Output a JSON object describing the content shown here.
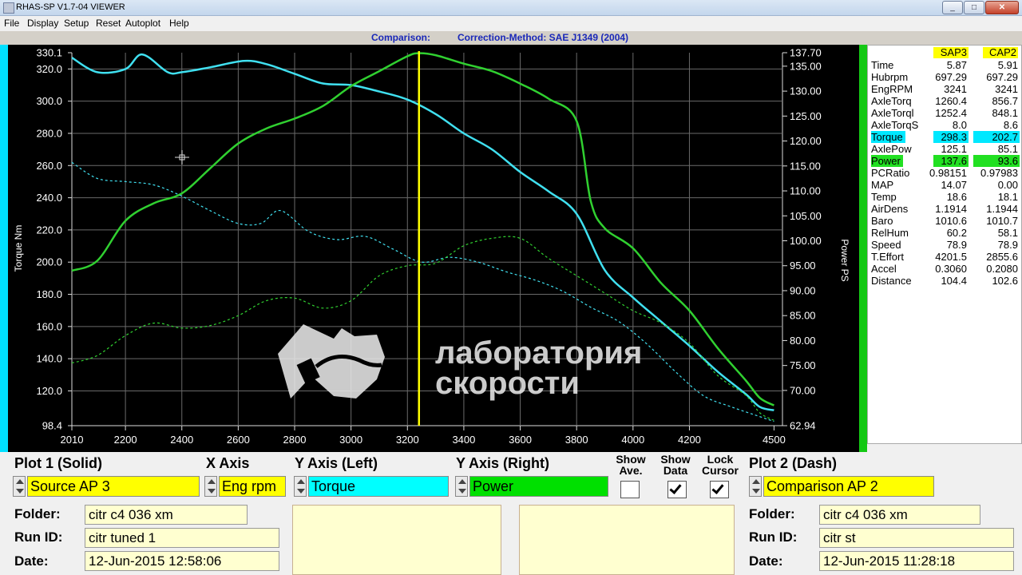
{
  "window": {
    "title": "RHAS-SP V1.7-04  VIEWER",
    "btn_min": "_",
    "btn_max": "□",
    "btn_close": "✕"
  },
  "menu": [
    "File",
    "Display",
    "Setup",
    "Reset",
    "Autoplot",
    "Help"
  ],
  "header": {
    "comparison": "Comparison:",
    "correction": "Correction-Method: SAE J1349 (2004)"
  },
  "watermark": {
    "line1": "лаборатория",
    "line2": "скорости"
  },
  "chart_data": {
    "type": "line",
    "xlabel": "",
    "ylabel_left": "Torque Nm",
    "ylabel_right": "Power PS",
    "x_ticks": [
      2010,
      2200,
      2400,
      2600,
      2800,
      3000,
      3200,
      3400,
      3600,
      3800,
      4000,
      4200,
      4500
    ],
    "left_ticks": [
      "330.1",
      "320.0",
      "300.0",
      "280.0",
      "260.0",
      "240.0",
      "220.0",
      "200.0",
      "180.0",
      "160.0",
      "140.0",
      "120.0",
      "98.4"
    ],
    "left_ylim": [
      98.4,
      330.1
    ],
    "right_ticks": [
      "137.70",
      "135.00",
      "130.00",
      "125.00",
      "120.00",
      "115.00",
      "110.00",
      "105.00",
      "100.00",
      "95.00",
      "90.00",
      "85.00",
      "80.00",
      "75.00",
      "70.00",
      "62.94"
    ],
    "right_ylim": [
      62.94,
      137.7
    ],
    "xlim": [
      2010,
      4530
    ],
    "cursor_rpm": 3241,
    "colors": {
      "torque": "#40e0f0",
      "power": "#30d030",
      "cursor": "#ffff00",
      "grid": "#6a6a6a"
    },
    "series": [
      {
        "name": "Torque",
        "axis": "left",
        "style": "solid",
        "color": "#40e0f0",
        "x": [
          2010,
          2100,
          2200,
          2260,
          2350,
          2400,
          2500,
          2620,
          2700,
          2800,
          2900,
          3000,
          3100,
          3200,
          3300,
          3400,
          3500,
          3600,
          3700,
          3800,
          3900,
          4000,
          4100,
          4200,
          4300,
          4400,
          4450,
          4500
        ],
        "y": [
          327,
          318,
          320,
          329,
          318,
          318,
          321,
          325,
          323,
          317,
          311,
          310,
          306,
          301,
          292,
          280,
          270,
          256,
          244,
          230,
          195,
          178,
          163,
          148,
          132,
          118,
          110,
          108
        ]
      },
      {
        "name": "Power",
        "axis": "right",
        "style": "solid",
        "color": "#30d030",
        "x": [
          2010,
          2100,
          2200,
          2300,
          2400,
          2500,
          2600,
          2700,
          2800,
          2900,
          3000,
          3100,
          3200,
          3241,
          3300,
          3400,
          3500,
          3600,
          3700,
          3800,
          3850,
          3900,
          4000,
          4100,
          4200,
          4300,
          4400,
          4450,
          4500
        ],
        "y": [
          94,
          96,
          104,
          107.5,
          109.5,
          114.5,
          119.5,
          122.5,
          124.5,
          127,
          131,
          134,
          137,
          137.6,
          137.2,
          135.5,
          134,
          131.5,
          128.5,
          124,
          108,
          102.5,
          98.5,
          91.5,
          86,
          78.5,
          72,
          68.5,
          67
        ]
      },
      {
        "name": "Comparison Torque",
        "axis": "left",
        "style": "dash",
        "color": "#40e0f0",
        "x": [
          2010,
          2100,
          2200,
          2300,
          2400,
          2500,
          2600,
          2680,
          2750,
          2850,
          2950,
          3050,
          3150,
          3250,
          3350,
          3450,
          3550,
          3650,
          3750,
          3850,
          3950,
          4050,
          4150,
          4250,
          4350,
          4450,
          4500
        ],
        "y": [
          262,
          252,
          250,
          248,
          241,
          232,
          224,
          224,
          232,
          219,
          214,
          216,
          208,
          200,
          203,
          200,
          194,
          189,
          182,
          172,
          163,
          149,
          132,
          117,
          110,
          104,
          101
        ]
      },
      {
        "name": "Comparison Power",
        "axis": "right",
        "style": "dash",
        "color": "#30d030",
        "x": [
          2010,
          2100,
          2200,
          2300,
          2400,
          2500,
          2600,
          2700,
          2800,
          2900,
          3000,
          3100,
          3200,
          3300,
          3400,
          3500,
          3600,
          3700,
          3800,
          3900,
          4000,
          4100,
          4200,
          4300,
          4400,
          4450,
          4500
        ],
        "y": [
          75.5,
          77,
          81,
          83.5,
          82.5,
          83,
          85,
          88,
          88.5,
          86.5,
          88,
          93,
          95,
          95.5,
          99,
          100.5,
          100.5,
          96.5,
          93,
          89.5,
          86,
          83.5,
          79.5,
          73,
          69,
          65.5,
          64
        ]
      }
    ]
  },
  "data_table": {
    "col1": "SAP3",
    "col2": "CAP2",
    "rows": [
      {
        "name": "Time",
        "v1": "5.87",
        "v2": "5.91",
        "hl": ""
      },
      {
        "name": "Hubrpm",
        "v1": "697.29",
        "v2": "697.29",
        "hl": ""
      },
      {
        "name": "EngRPM",
        "v1": "3241",
        "v2": "3241",
        "hl": ""
      },
      {
        "name": "AxleTorq",
        "v1": "1260.4",
        "v2": "856.7",
        "hl": ""
      },
      {
        "name": "AxleTorql",
        "v1": "1252.4",
        "v2": "848.1",
        "hl": ""
      },
      {
        "name": "AxleTorqS",
        "v1": "8.0",
        "v2": "8.6",
        "hl": ""
      },
      {
        "name": "Torque",
        "v1": "298.3",
        "v2": "202.7",
        "hl": "cyan"
      },
      {
        "name": "AxlePow",
        "v1": "125.1",
        "v2": "85.1",
        "hl": ""
      },
      {
        "name": "Power",
        "v1": "137.6",
        "v2": "93.6",
        "hl": "green"
      },
      {
        "name": "PCRatio",
        "v1": "0.98151",
        "v2": "0.97983",
        "hl": ""
      },
      {
        "name": "MAP",
        "v1": "14.07",
        "v2": "0.00",
        "hl": ""
      },
      {
        "name": "Temp",
        "v1": "18.6",
        "v2": "18.1",
        "hl": ""
      },
      {
        "name": "AirDens",
        "v1": "1.1914",
        "v2": "1.1944",
        "hl": ""
      },
      {
        "name": "Baro",
        "v1": "1010.6",
        "v2": "1010.7",
        "hl": ""
      },
      {
        "name": "RelHum",
        "v1": "60.2",
        "v2": "58.1",
        "hl": ""
      },
      {
        "name": "Speed",
        "v1": "78.9",
        "v2": "78.9",
        "hl": ""
      },
      {
        "name": "T.Effort",
        "v1": "4201.5",
        "v2": "2855.6",
        "hl": ""
      },
      {
        "name": "Accel",
        "v1": "0.3060",
        "v2": "0.2080",
        "hl": ""
      },
      {
        "name": "Distance",
        "v1": "104.4",
        "v2": "102.6",
        "hl": ""
      }
    ]
  },
  "controls": {
    "plot1_title": "Plot 1 (Solid)",
    "xaxis_title": "X Axis",
    "yleft_title": "Y Axis (Left)",
    "yright_title": "Y Axis (Right)",
    "show_ave": "Show Ave.",
    "show_data": "Show Data",
    "lock_cursor": "Lock Cursor",
    "plot2_title": "Plot 2 (Dash)",
    "plot1_value": "Source AP 3",
    "xaxis_value": "Eng rpm",
    "yleft_value": "Torque",
    "yright_value": "Power",
    "plot2_value": "Comparison AP 2",
    "show_ave_checked": false,
    "show_data_checked": true,
    "lock_cursor_checked": true,
    "colors": {
      "plot1": "#ffff00",
      "xaxis": "#ffff00",
      "yleft": "#00ffff",
      "yright": "#00e000",
      "plot2": "#ffff00"
    }
  },
  "run1": {
    "folder_label": "Folder:",
    "folder": "citr c4 036 xm",
    "runid_label": "Run ID:",
    "runid": "citr tuned 1",
    "date_label": "Date:",
    "date": "12-Jun-2015  12:58:06"
  },
  "run2": {
    "folder_label": "Folder:",
    "folder": "citr c4 036 xm",
    "runid_label": "Run ID:",
    "runid": "citr st",
    "date_label": "Date:",
    "date": "12-Jun-2015  11:28:18"
  }
}
